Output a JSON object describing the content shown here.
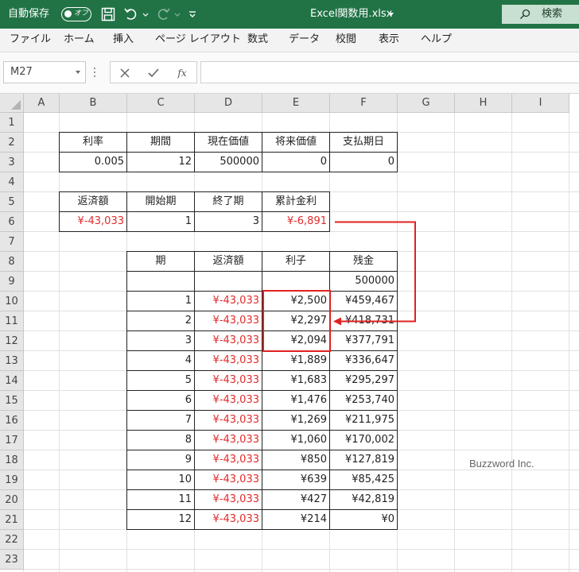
{
  "titlebar": {
    "autosave_label": "自動保存",
    "autosave_state": "オフ",
    "file_title": "Excel関数用.xlsx",
    "search_label": "検索"
  },
  "menu": [
    "ファイル",
    "ホーム",
    "挿入",
    "ページ レイアウト",
    "数式",
    "データ",
    "校閲",
    "表示",
    "ヘルプ"
  ],
  "formula_bar": {
    "name_box": "M27",
    "fx": "fx",
    "formula": ""
  },
  "columns": [
    "A",
    "B",
    "C",
    "D",
    "E",
    "F",
    "G",
    "H",
    "I"
  ],
  "rows": [
    "1",
    "2",
    "3",
    "4",
    "5",
    "6",
    "7",
    "8",
    "9",
    "10",
    "11",
    "12",
    "13",
    "14",
    "15",
    "16",
    "17",
    "18",
    "19",
    "20",
    "21",
    "22",
    "23"
  ],
  "params_table": {
    "headers": [
      "利率",
      "期間",
      "現在価値",
      "将来価値",
      "支払期日"
    ],
    "values": [
      "0.005",
      "12",
      "500000",
      "0",
      "0"
    ]
  },
  "result_table": {
    "headers": [
      "返済額",
      "開始期",
      "終了期",
      "累計金利"
    ],
    "values": [
      "¥-43,033",
      "1",
      "3",
      "¥-6,891"
    ]
  },
  "schedule_table": {
    "headers": [
      "期",
      "返済額",
      "利子",
      "残金"
    ],
    "initial_balance": "500000",
    "rows": [
      [
        "1",
        "¥-43,033",
        "¥2,500",
        "¥459,467"
      ],
      [
        "2",
        "¥-43,033",
        "¥2,297",
        "¥418,731"
      ],
      [
        "3",
        "¥-43,033",
        "¥2,094",
        "¥377,791"
      ],
      [
        "4",
        "¥-43,033",
        "¥1,889",
        "¥336,647"
      ],
      [
        "5",
        "¥-43,033",
        "¥1,683",
        "¥295,297"
      ],
      [
        "6",
        "¥-43,033",
        "¥1,476",
        "¥253,740"
      ],
      [
        "7",
        "¥-43,033",
        "¥1,269",
        "¥211,975"
      ],
      [
        "8",
        "¥-43,033",
        "¥1,060",
        "¥170,002"
      ],
      [
        "9",
        "¥-43,033",
        "¥850",
        "¥127,819"
      ],
      [
        "10",
        "¥-43,033",
        "¥639",
        "¥85,425"
      ],
      [
        "11",
        "¥-43,033",
        "¥427",
        "¥42,819"
      ],
      [
        "12",
        "¥-43,033",
        "¥214",
        "¥0"
      ]
    ]
  },
  "colors": {
    "excel_green": "#217346",
    "negative_red": "#e22b2b",
    "annotation_red": "#e02020"
  },
  "watermark": "Buzzword Inc."
}
